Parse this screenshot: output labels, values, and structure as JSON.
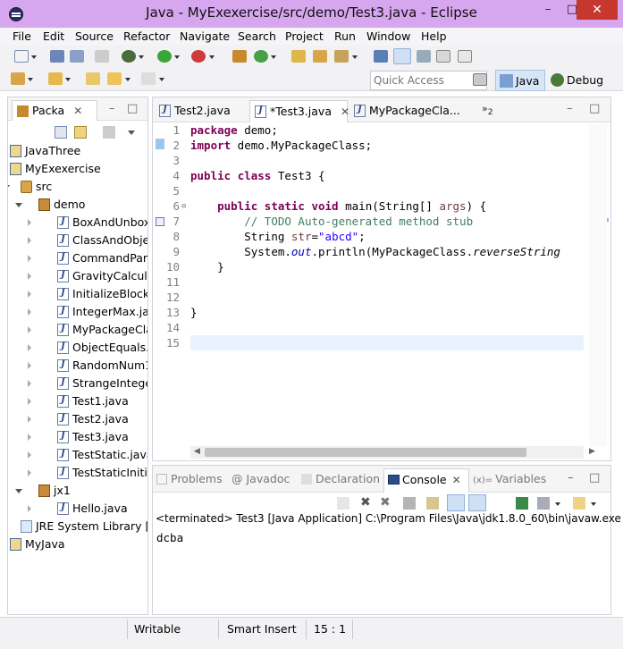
{
  "window": {
    "title": "Java - MyExexercise/src/demo/Test3.java - Eclipse"
  },
  "menu": [
    "File",
    "Edit",
    "Source",
    "Refactor",
    "Navigate",
    "Search",
    "Project",
    "Run",
    "Window",
    "Help"
  ],
  "toolbar": {
    "quick_access_placeholder": "Quick Access",
    "perspective_java": "Java",
    "perspective_debug": "Debug"
  },
  "explorer": {
    "tab_label": "Packa",
    "items": [
      {
        "label": "JavaThree",
        "indent": 0
      },
      {
        "label": "MyExexercise",
        "indent": 0
      },
      {
        "label": "src",
        "indent": 1
      },
      {
        "label": "demo",
        "indent": 2
      },
      {
        "label": "BoxAndUnbox",
        "indent": 3
      },
      {
        "label": "ClassAndObje",
        "indent": 3
      },
      {
        "label": "CommandPara",
        "indent": 3
      },
      {
        "label": "GravityCalcula",
        "indent": 3
      },
      {
        "label": "InitializeBlockI",
        "indent": 3
      },
      {
        "label": "IntegerMax.jav",
        "indent": 3
      },
      {
        "label": "MyPackageCla",
        "indent": 3
      },
      {
        "label": "ObjectEquals.j",
        "indent": 3
      },
      {
        "label": "RandomNum1",
        "indent": 3
      },
      {
        "label": "StrangeIntege",
        "indent": 3
      },
      {
        "label": "Test1.java",
        "indent": 3
      },
      {
        "label": "Test2.java",
        "indent": 3
      },
      {
        "label": "Test3.java",
        "indent": 3
      },
      {
        "label": "TestStatic.java",
        "indent": 3
      },
      {
        "label": "TestStaticInitia",
        "indent": 3
      },
      {
        "label": "jx1",
        "indent": 2
      },
      {
        "label": "Hello.java",
        "indent": 3
      },
      {
        "label": "JRE System Library [",
        "indent": 1
      },
      {
        "label": "MyJava",
        "indent": 0
      }
    ]
  },
  "editor": {
    "tabs": [
      "Test2.java",
      "*Test3.java",
      "MyPackageCla...",
      "2"
    ],
    "line_numbers": [
      "1",
      "2",
      "3",
      "4",
      "5",
      "6",
      "7",
      "8",
      "9",
      "10",
      "11",
      "12",
      "13",
      "14",
      "15"
    ],
    "code": {
      "l1_kw": "package",
      "l1_rest": " demo;",
      "l2_kw": "import",
      "l2_rest": " demo.MyPackageClass;",
      "l4_kw1": "public",
      "l4_kw2": "class",
      "l4_rest": " Test3 {",
      "l6_kw1": "public",
      "l6_kw2": "static",
      "l6_kw3": "void",
      "l6_mid": " main(String[] ",
      "l6_args": "args",
      "l6_end": ") {",
      "l7_comment": "// TODO Auto-generated method stub",
      "l8_type": "String ",
      "l8_var": "str",
      "l8_eq": "=",
      "l8_str": "\"abcd\"",
      "l8_end": ";",
      "l9_a": "System.",
      "l9_out": "out",
      "l9_b": ".println(MyPackageClass.",
      "l9_m": "reverseString",
      "l10": "}",
      "l13": "}"
    }
  },
  "console": {
    "tabs": [
      "Problems",
      "Javadoc",
      "Declaration",
      "Console",
      "Variables"
    ],
    "terminated_line": "<terminated> Test3 [Java Application] C:\\Program Files\\Java\\jdk1.8.0_60\\bin\\javaw.exe (",
    "output": "dcba"
  },
  "status": {
    "writable": "Writable",
    "insert_mode": "Smart Insert",
    "cursor_position": "15 : 1"
  },
  "colors": {
    "titlebar": "#d6a6ee",
    "close_button": "#c7372e",
    "keyword": "#7f0055",
    "comment": "#3f7f5f",
    "string": "#2a00ff"
  }
}
